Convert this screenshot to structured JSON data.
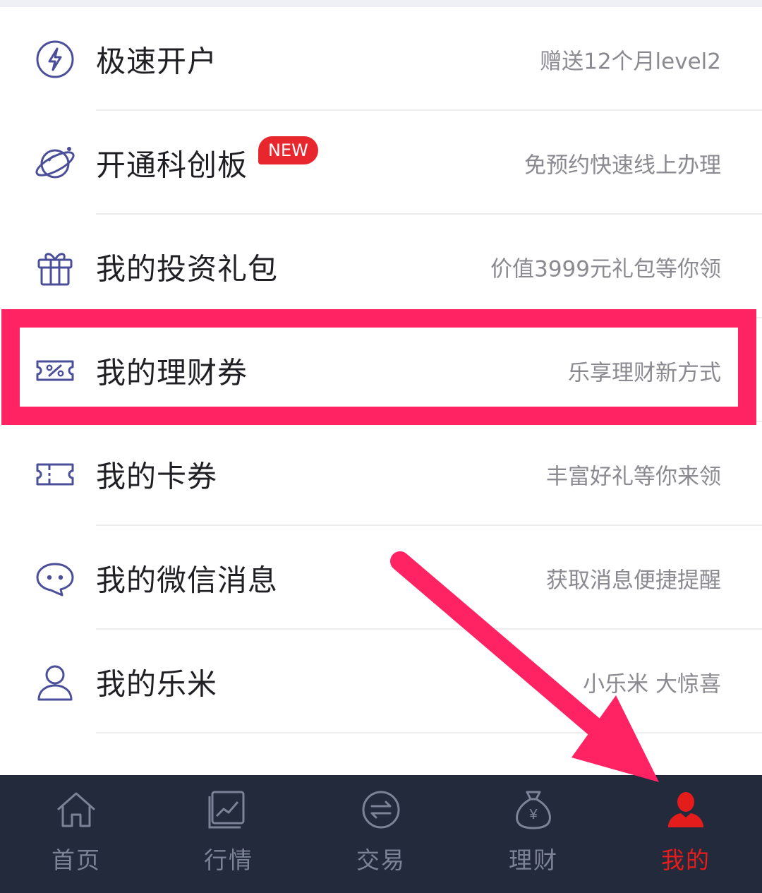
{
  "menu": {
    "items": [
      {
        "title": "极速开户",
        "subtitle": "赠送12个月level2",
        "icon": "lightning-icon"
      },
      {
        "title": "开通科创板",
        "subtitle": "免预约快速线上办理",
        "icon": "planet-icon",
        "badge": "NEW"
      },
      {
        "title": "我的投资礼包",
        "subtitle": "价值3999元礼包等你领",
        "icon": "gift-icon"
      },
      {
        "title": "我的理财券",
        "subtitle": "乐享理财新方式",
        "icon": "percent-coupon-icon"
      },
      {
        "title": "我的卡券",
        "subtitle": "丰富好礼等你来领",
        "icon": "ticket-icon"
      },
      {
        "title": "我的微信消息",
        "subtitle": "获取消息便捷提醒",
        "icon": "chat-bubble-icon"
      },
      {
        "title": "我的乐米",
        "subtitle": "小乐米 大惊喜",
        "icon": "user-icon"
      }
    ]
  },
  "tabbar": {
    "tabs": [
      {
        "label": "首页",
        "icon": "home-icon"
      },
      {
        "label": "行情",
        "icon": "chart-icon"
      },
      {
        "label": "交易",
        "icon": "exchange-icon"
      },
      {
        "label": "理财",
        "icon": "money-bag-icon"
      },
      {
        "label": "我的",
        "icon": "profile-icon",
        "active": true
      }
    ]
  },
  "colors": {
    "accent": "#e51c1c",
    "highlight": "#ff2363",
    "icon": "#4b4f9a",
    "tabbar_bg": "#232a3c"
  }
}
